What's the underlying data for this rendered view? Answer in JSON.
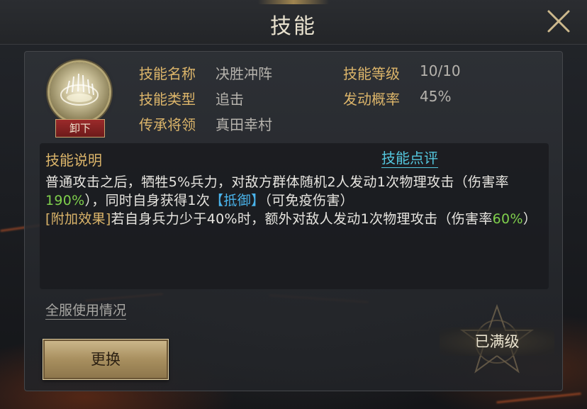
{
  "header": {
    "title": "技能"
  },
  "skill": {
    "unequip_label": "卸下",
    "fields": {
      "name": {
        "label": "技能名称",
        "value": "决胜冲阵"
      },
      "level": {
        "label": "技能等级",
        "value": "10/10"
      },
      "type": {
        "label": "技能类型",
        "value": "追击"
      },
      "chance": {
        "label": "发动概率",
        "value": "45%"
      },
      "inherit": {
        "label": "传承将领",
        "value": "真田幸村"
      }
    }
  },
  "description": {
    "title": "技能说明",
    "review_link": "技能点评",
    "line1_a": "普通攻击之后，牺牲5%兵力，对敌方群体随机2人发动1次物理攻击（伤害率",
    "line1_pct": "190%",
    "line1_b": "），同时自身获得1次",
    "line1_status": "【抵御】",
    "line1_c": "（可免疫伤害）",
    "line2_tag": "[附加效果]",
    "line2_a": "若自身兵力少于40%时，额外对敌人发动1次物理攻击（伤害率",
    "line2_pct": "60%",
    "line2_b": "）"
  },
  "footer": {
    "usage_link": "全服使用情况",
    "replace_label": "更换",
    "maxed_label": "已满级"
  },
  "colors": {
    "label_gold": "#dcb56a",
    "value_gray": "#b6b3ad",
    "highlight_green": "#7fcf4c",
    "status_blue": "#4ab3ea",
    "link_cyan": "#54c7de"
  }
}
